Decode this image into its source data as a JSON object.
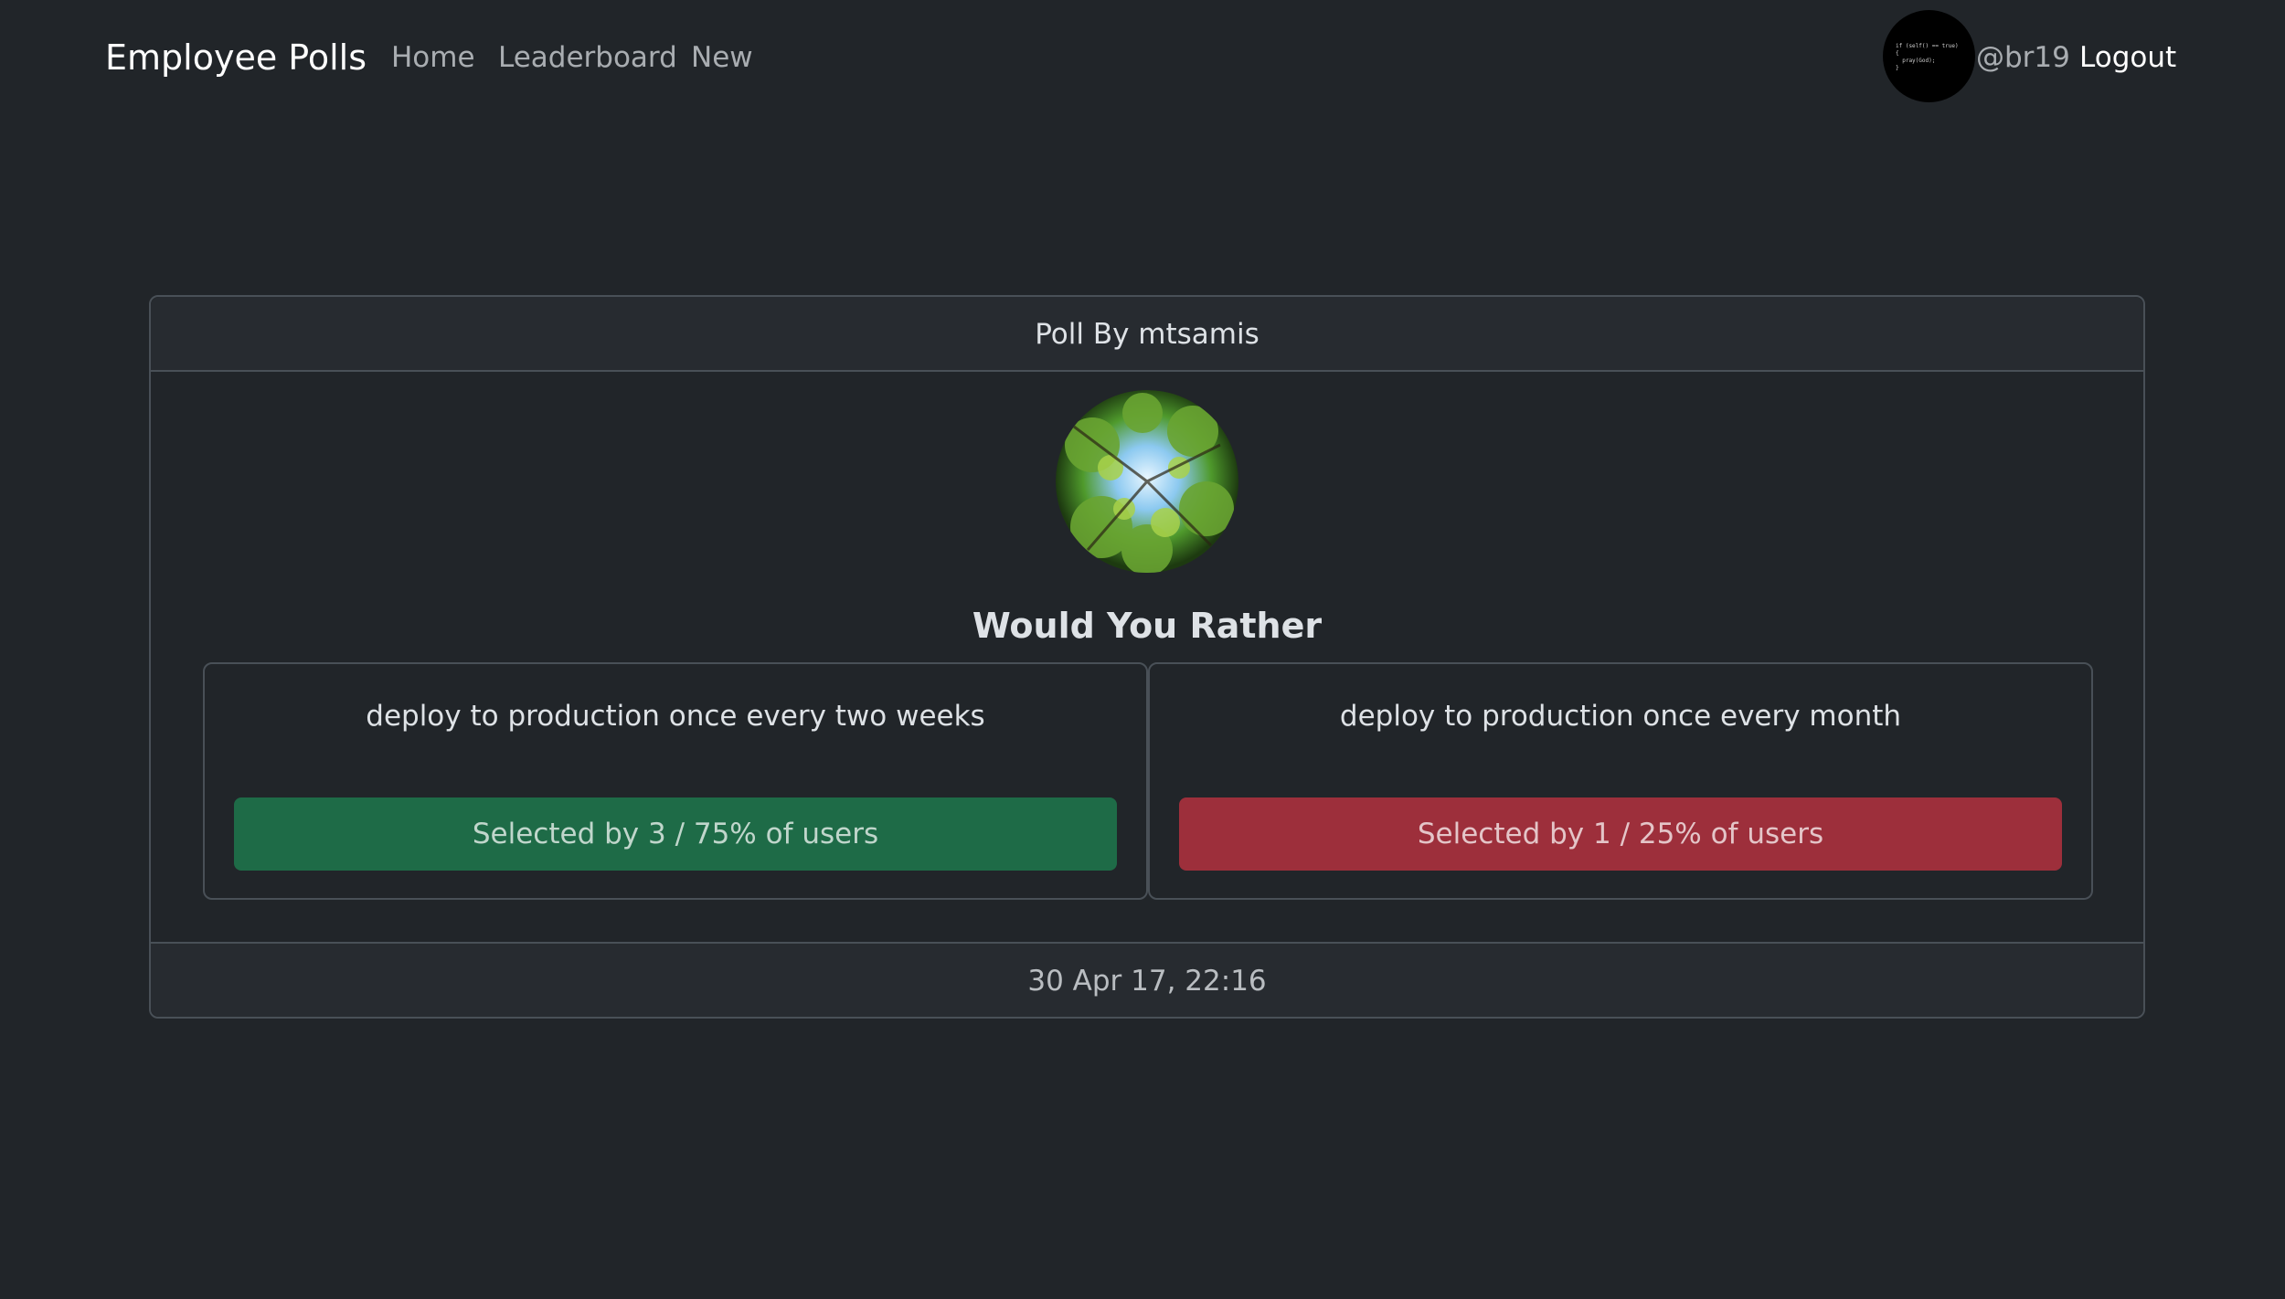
{
  "navbar": {
    "brand": "Employee Polls",
    "links": [
      {
        "label": "Home"
      },
      {
        "label": "Leaderboard"
      },
      {
        "label": "New"
      }
    ],
    "user": {
      "avatar_code": "if (self() == true)\n{\n  pray(God);\n}",
      "username": "@br19",
      "logout_label": "Logout"
    }
  },
  "poll": {
    "header": "Poll By mtsamis",
    "title": "Would You Rather",
    "options": [
      {
        "text": "deploy to production once every two weeks",
        "result": "Selected by 3 / 75% of users",
        "percent": 75,
        "color": "#1e6b47"
      },
      {
        "text": "deploy to production once every month",
        "result": "Selected by 1 / 25% of users",
        "percent": 25,
        "color": "#9d2f3b"
      }
    ],
    "timestamp": "30 Apr 17, 22:16"
  },
  "icons": {
    "author_avatar": "tree-canopy-avatar",
    "user_avatar": "code-avatar"
  }
}
